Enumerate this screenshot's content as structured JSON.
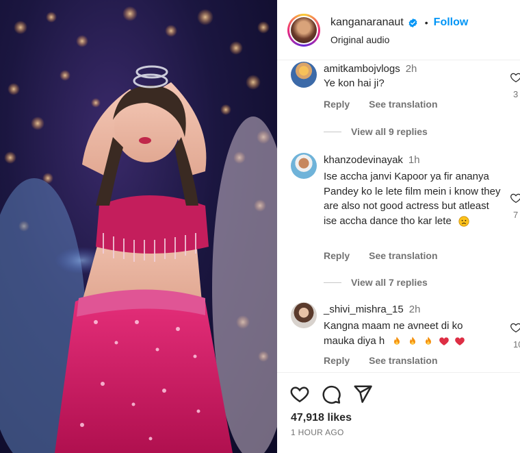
{
  "post": {
    "username": "kanganaranaut",
    "separator": "•",
    "follow_label": "Follow",
    "audio_label": "Original audio"
  },
  "comments": [
    {
      "username": "amitkambojvlogs",
      "time": "2h",
      "text": "Ye kon hai ji?",
      "reply_label": "Reply",
      "translate_label": "See translation",
      "like_count": "3",
      "view_replies": "View all 9 replies"
    },
    {
      "username": "khanzodevinayak",
      "time": "1h",
      "text": "Ise accha janvi Kapoor ya fir ananya Pandey ko le lete film mein i know they are also not good actress but atleast ise accha dance tho kar lete",
      "reply_label": "Reply",
      "translate_label": "See translation",
      "like_count": "7",
      "view_replies": "View all 7 replies"
    },
    {
      "username": "_shivi_mishra_15",
      "time": "2h",
      "text_line1": "Kangna maam ne avneet di ko",
      "text_line2": "mauka diya h",
      "reply_label": "Reply",
      "translate_label": "See translation",
      "like_count": "10"
    }
  ],
  "footer": {
    "likes": "47,918 likes",
    "posted": "1 HOUR AGO"
  },
  "icons": {
    "like": "heart-icon",
    "comment": "comment-bubble-icon",
    "share": "paper-plane-icon",
    "verified": "verified-badge-icon"
  },
  "colors": {
    "accent": "#0095f6",
    "muted": "#737373",
    "text": "#262626",
    "outfit": "#d4206e"
  }
}
